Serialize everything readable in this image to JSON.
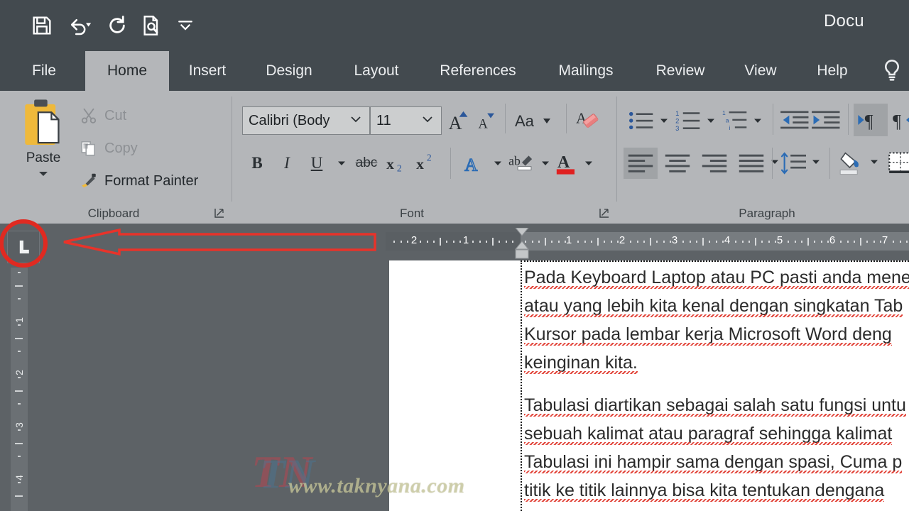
{
  "window": {
    "title": "Docu",
    "full_title_visible": "Docu"
  },
  "quick_access": {
    "items": [
      {
        "name": "save-icon",
        "label": "Save"
      },
      {
        "name": "undo-icon",
        "label": "Undo"
      },
      {
        "name": "redo-icon",
        "label": "Repeat"
      },
      {
        "name": "print-preview-icon",
        "label": "Print Preview and Print"
      },
      {
        "name": "customize-qat-icon",
        "label": "Customize Quick Access Toolbar"
      }
    ]
  },
  "ribbon": {
    "tabs": [
      {
        "label": "File",
        "active": false
      },
      {
        "label": "Home",
        "active": true
      },
      {
        "label": "Insert",
        "active": false
      },
      {
        "label": "Design",
        "active": false
      },
      {
        "label": "Layout",
        "active": false
      },
      {
        "label": "References",
        "active": false
      },
      {
        "label": "Mailings",
        "active": false
      },
      {
        "label": "Review",
        "active": false
      },
      {
        "label": "View",
        "active": false
      },
      {
        "label": "Help",
        "active": false
      }
    ],
    "tell_me_icon": "lightbulb-icon",
    "groups": [
      {
        "label": "Clipboard"
      },
      {
        "label": "Font"
      },
      {
        "label": "Paragraph"
      }
    ],
    "clipboard": {
      "paste_label": "Paste",
      "cut_label": "Cut",
      "copy_label": "Copy",
      "format_painter_label": "Format Painter"
    },
    "font": {
      "font_name_value": "Calibri (Body",
      "font_size_value": "11",
      "bold_label": "B",
      "italic_label": "I",
      "underline_label": "U",
      "strikethrough_label": "abc",
      "subscript_label": "x",
      "subscript_sub": "2",
      "superscript_label": "x",
      "superscript_sup": "2",
      "change_case_label": "Aa",
      "grow_font_label": "A",
      "shrink_font_label": "A",
      "clear_formatting_icon": "clear-formatting-icon",
      "text_effects_label": "A",
      "text_highlight_label": "ab",
      "font_color_label": "A",
      "font_color_swatch": "#e02020"
    },
    "paragraph": {
      "bullets_icon": "bullet-list-icon",
      "numbering_icon": "numbered-list-icon",
      "multilevel_icon": "multilevel-list-icon",
      "decrease_indent_icon": "decrease-indent-icon",
      "increase_indent_icon": "increase-indent-icon",
      "ltr_icon": "left-to-right-icon",
      "rtl_icon": "right-to-left-icon",
      "align_left_icon": "align-left-icon",
      "align_center_icon": "align-center-icon",
      "align_right_icon": "align-right-icon",
      "justify_icon": "justify-icon",
      "line_spacing_icon": "line-spacing-icon",
      "shading_icon": "shading-icon",
      "borders_icon": "borders-icon"
    }
  },
  "ruler": {
    "tab_stop_selector_glyph": "L",
    "tab_stop_selector_name": "left-tab-stop",
    "horizontal_left_numbers": [
      "2",
      "1"
    ],
    "horizontal_right_numbers": [
      "1",
      "2",
      "3",
      "4",
      "5",
      "6",
      "7"
    ],
    "vertical_numbers": [
      "1",
      "2",
      "3",
      "4"
    ]
  },
  "document": {
    "paragraphs": [
      [
        "Pada Keyboard Laptop atau PC pasti anda mene",
        "atau yang lebih kita kenal dengan singkatan Tab",
        "Kursor pada lembar kerja Microsoft Word deng",
        "keinginan kita."
      ],
      [
        "Tabulasi diartikan sebagai salah satu fungsi untu",
        "sebuah kalimat atau paragraf sehingga kalimat",
        "Tabulasi ini hampir sama dengan spasi, Cuma p",
        "titik ke titik lainnya bisa kita tentukan dengana"
      ]
    ]
  },
  "watermark": {
    "logo": "TN",
    "url": "www.taknyana.com"
  },
  "annotations": {
    "circle_color": "#e02a21",
    "arrow_color": "#e8332a",
    "circle_target": "tab-stop-selector",
    "arrow_direction": "left"
  },
  "colors": {
    "titlebar": "#434a4f",
    "ribbon": "#b4b6b9",
    "workspace": "#5d6266",
    "ruler": "#6b7074",
    "page": "#ffffff",
    "accent_blue": "#2b579a",
    "spell_error": "#e03b30"
  }
}
